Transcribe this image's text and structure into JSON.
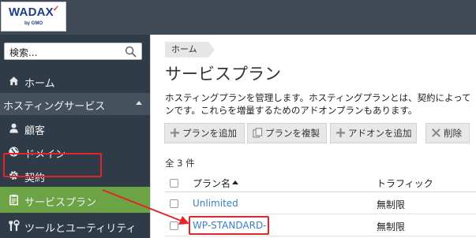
{
  "brand": {
    "logo_text": "WADAX",
    "logo_sub": "by GMO",
    "accent": "#6ba345",
    "highlight": "#e3242b"
  },
  "sidebar": {
    "search": {
      "value": "検索..."
    },
    "items": [
      {
        "label": "ホーム",
        "icon": "home-icon"
      },
      {
        "label": "ホスティングサービス",
        "icon": "caret-up-icon"
      },
      {
        "label": "顧客",
        "icon": "user-icon"
      },
      {
        "label": "ドメイン",
        "icon": "globe-icon"
      },
      {
        "label": "契約",
        "icon": "gear-icon"
      },
      {
        "label": "サービスプラン",
        "icon": "clipboard-icon"
      },
      {
        "label": "ツールとユーティリティ",
        "icon": "tools-icon"
      }
    ]
  },
  "main": {
    "breadcrumb": "ホーム",
    "title": "サービスプラン",
    "description_line1": "ホスティングプランを管理します。ホスティングプランとは、契約によって",
    "description_line2": "ンです。これらを増量するためのアドオンプランもあります。",
    "toolbar": {
      "add_plan": "プランを追加",
      "duplicate_plan": "プランを複製",
      "add_addon": "アドオンを追加",
      "delete": "削除"
    },
    "count": "全 3 件",
    "table": {
      "columns": [
        "プラン名",
        "トラフィック"
      ],
      "rows": [
        {
          "name": "Unlimited",
          "traffic": "無制限"
        },
        {
          "name": "WP-STANDARD-",
          "traffic": "無制限"
        }
      ]
    }
  }
}
